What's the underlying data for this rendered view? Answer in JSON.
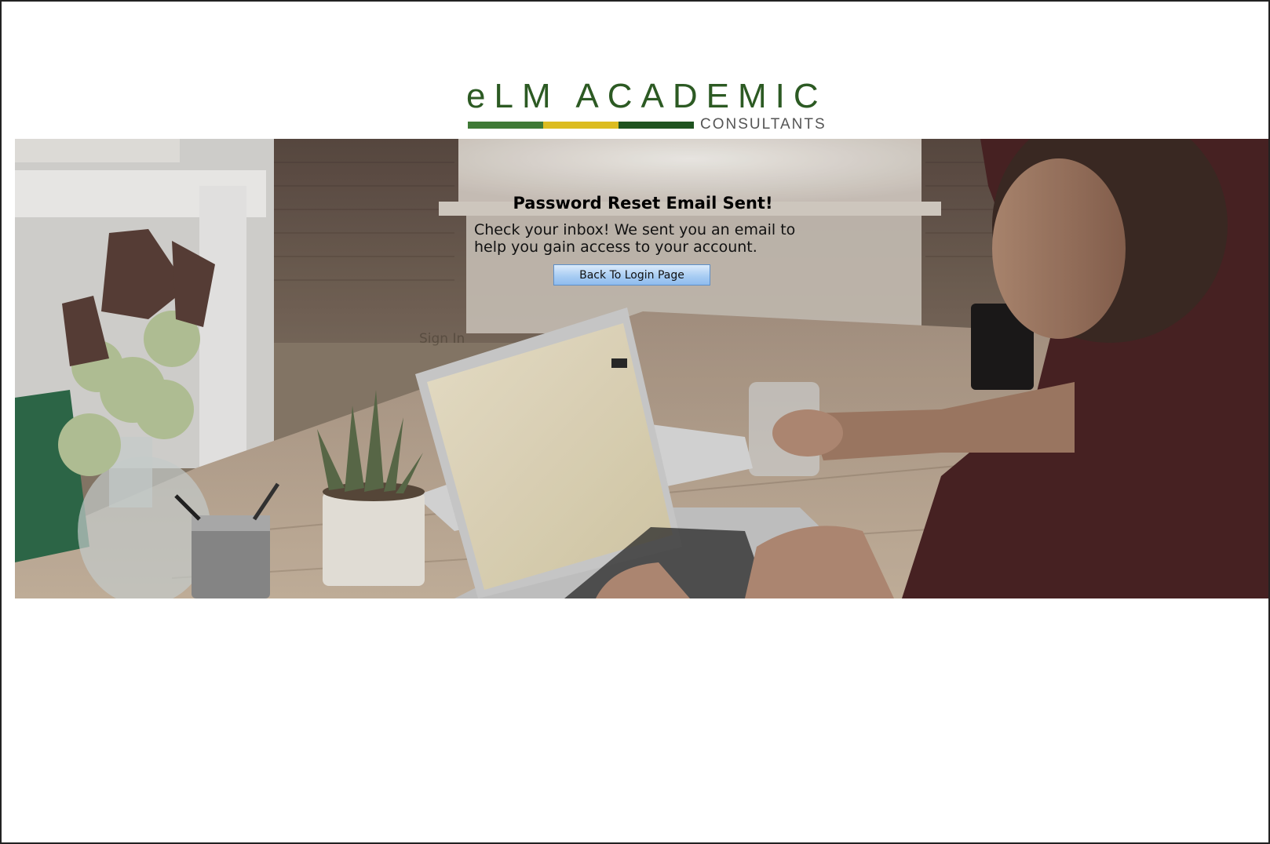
{
  "brand": {
    "title": "eLM ACADEMIC",
    "subtitle": "CONSULTANTS",
    "colors": {
      "green": "#3f7a36",
      "yellow": "#dcbc21",
      "dark_green": "#1f5320",
      "text": "#2c5a23"
    }
  },
  "reset": {
    "heading": "Password Reset Email Sent!",
    "message": "Check your inbox! We sent you an email to help you gain access to your account.",
    "back_button_label": "Back To Login Page"
  },
  "background": {
    "ghost_label": "Sign In"
  }
}
